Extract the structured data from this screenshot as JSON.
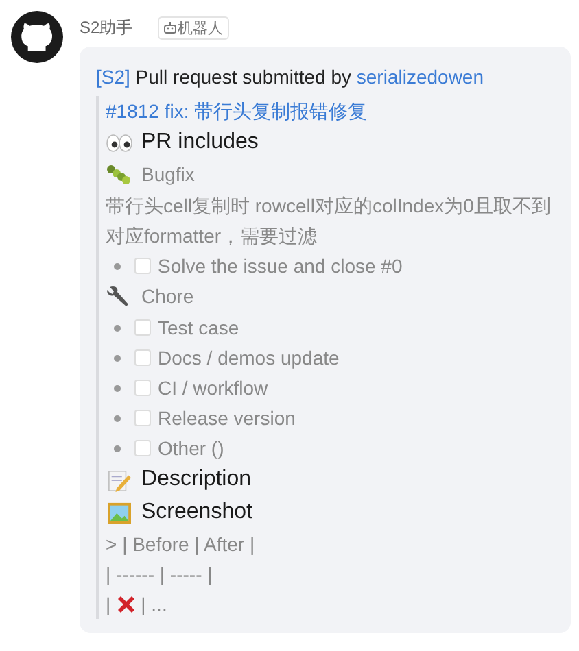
{
  "sender": {
    "name": "S2助手",
    "badge": "机器人"
  },
  "message": {
    "prefix": "[S2]",
    "title": "Pull request submitted by",
    "author": "serializedowen",
    "pr_link": "#1812 fix: 带行头复制报错修复",
    "blocks": [
      {
        "kind": "heading",
        "text": "PR includes"
      },
      {
        "kind": "subheading",
        "text": "Bugfix"
      },
      {
        "kind": "paragraph",
        "text": "带行头cell复制时 rowcell对应的colIndex为0且取不到对应formatter，需要过滤"
      },
      {
        "kind": "tasks",
        "items": [
          {
            "text": "Solve the issue and close #0",
            "checked": false
          }
        ]
      },
      {
        "kind": "subheading",
        "text": "Chore"
      },
      {
        "kind": "tasks",
        "items": [
          {
            "text": "Test case",
            "checked": false
          },
          {
            "text": "Docs / demos update",
            "checked": false
          },
          {
            "text": "CI / workflow",
            "checked": false
          },
          {
            "text": "Release version",
            "checked": false
          },
          {
            "text": "Other ()",
            "checked": false
          }
        ]
      },
      {
        "kind": "heading",
        "text": "Description"
      },
      {
        "kind": "heading",
        "text": "Screenshot"
      },
      {
        "kind": "paragraph",
        "text": "> | Before | After |"
      },
      {
        "kind": "paragraph",
        "text": "| ------ | ----- |"
      },
      {
        "kind": "cross-row",
        "before": "|",
        "after": "| ..."
      }
    ]
  }
}
